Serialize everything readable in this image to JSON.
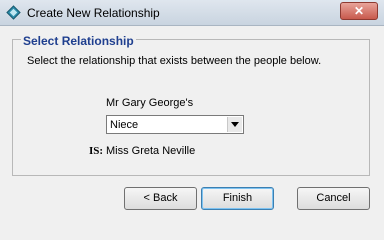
{
  "window": {
    "title": "Create New Relationship",
    "close_glyph": "✕"
  },
  "group": {
    "legend": "Select Relationship",
    "instructions": "Select the relationship that exists between the people below."
  },
  "relationship": {
    "owner": "Mr Gary George's",
    "selected": "Niece",
    "is_label": "IS:",
    "target": "Miss Greta Neville"
  },
  "buttons": {
    "back": "< Back",
    "finish": "Finish",
    "cancel": "Cancel"
  },
  "colors": {
    "legend": "#1f3f8f",
    "default_button_border": "#3c7fb1"
  },
  "icons": {
    "app": "diamond-app-icon",
    "close": "close-icon",
    "dropdown": "chevron-down-icon"
  }
}
